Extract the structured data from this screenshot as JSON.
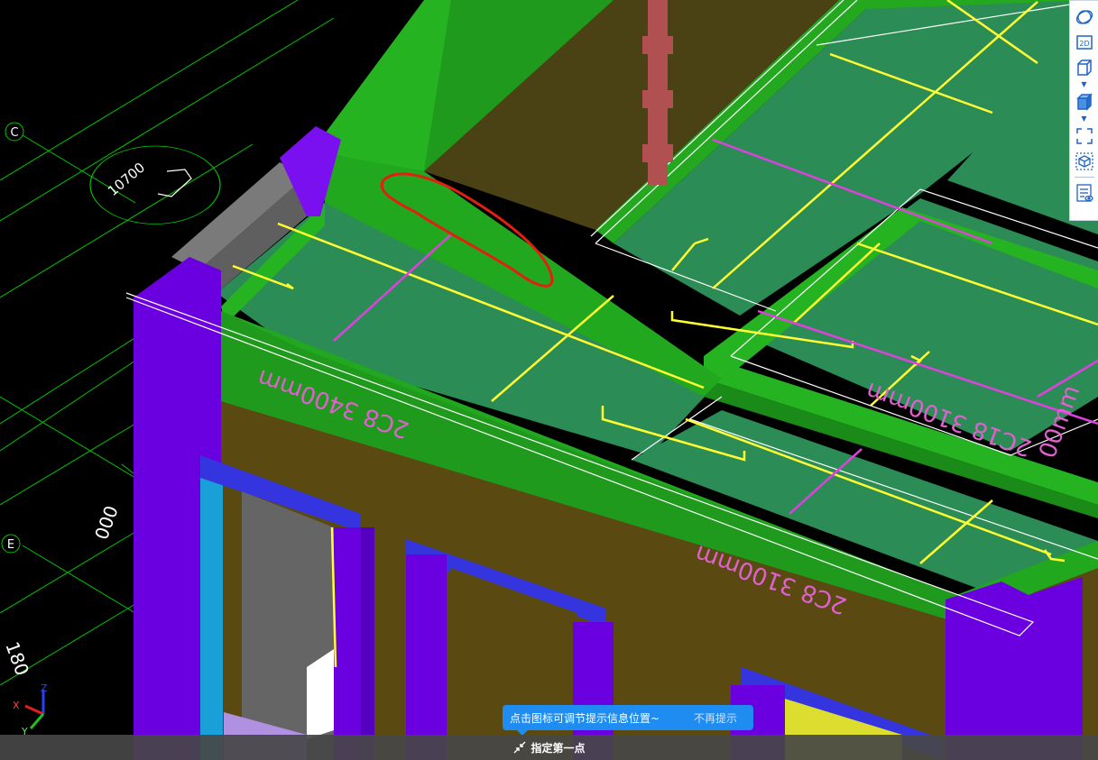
{
  "viewport": {
    "axis_labels": {
      "c": "C",
      "e": "E"
    },
    "dimension_text": "10700",
    "dimension_text_2": "000",
    "dimension_text_3": "180",
    "rebar_labels": {
      "slab_left": "2C8 3400mm",
      "slab_front": "2C8 3100mm",
      "slab_right_a": "2C18 3100mm",
      "slab_right_b": "00mm"
    },
    "gizmo": {
      "x": "X",
      "y": "Y",
      "z": "Z"
    },
    "colors": {
      "beam_green": "#22a81e",
      "slab_teal": "#2c8c56",
      "column_purple": "#6a00e0",
      "wall_olive": "#5a4a12",
      "rebar_yellow": "#ffff33",
      "rebar_magenta": "#e040e0",
      "annotation_red": "#e02010",
      "grid_green": "#00c800"
    }
  },
  "toolbar": {
    "items": [
      {
        "name": "orbit-icon"
      },
      {
        "name": "2d-view-icon",
        "label": "2D"
      },
      {
        "name": "3d-wireframe-icon"
      },
      {
        "name": "3d-solid-icon"
      },
      {
        "name": "zoom-extents-icon"
      },
      {
        "name": "view-cube-icon"
      },
      {
        "name": "properties-icon"
      }
    ]
  },
  "tooltip": {
    "message": "点击图标可调节提示信息位置~",
    "dismiss": "不再提示"
  },
  "statusbar": {
    "prompt": "指定第一点"
  }
}
